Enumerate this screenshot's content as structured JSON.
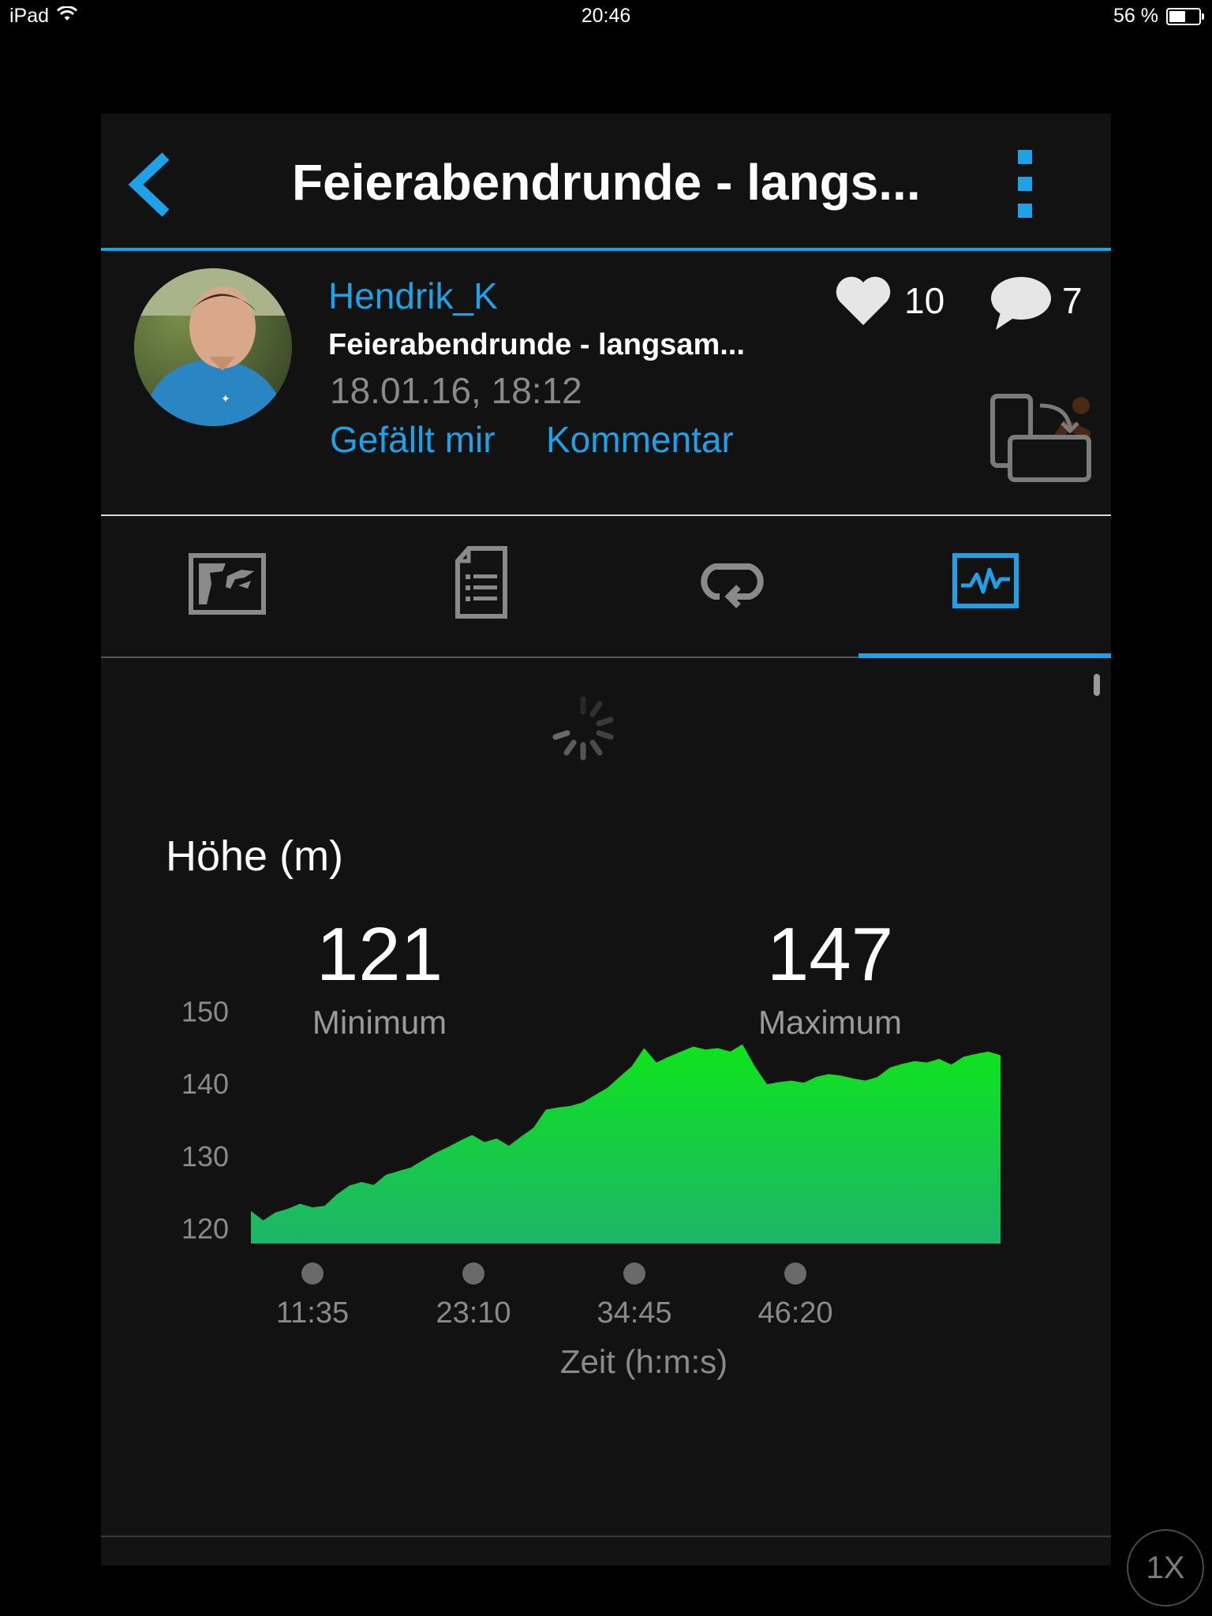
{
  "status_bar": {
    "carrier": "iPad",
    "time": "20:46",
    "battery": "56 %"
  },
  "header": {
    "title": "Feierabendrunde - langs..."
  },
  "activity": {
    "user": "Hendrik_K",
    "name": "Feierabendrunde - langsam...",
    "datetime": "18.01.16, 18:12",
    "like_label": "Gefällt mir",
    "comment_label": "Kommentar",
    "likes": "10",
    "comments": "7"
  },
  "tabs": [
    {
      "name": "map",
      "icon": "map-icon",
      "active": false
    },
    {
      "name": "details",
      "icon": "document-list-icon",
      "active": false
    },
    {
      "name": "laps",
      "icon": "loop-icon",
      "active": false
    },
    {
      "name": "charts",
      "icon": "chart-icon",
      "active": true
    }
  ],
  "elevation": {
    "title": "Höhe (m)",
    "min_value": "121",
    "min_label": "Minimum",
    "max_value": "147",
    "max_label": "Maximum"
  },
  "chart_data": {
    "type": "area",
    "ylim": [
      118,
      152
    ],
    "yticks": [
      "150",
      "140",
      "130",
      "120"
    ],
    "xticks": [
      "11:35",
      "23:10",
      "34:45",
      "46:20"
    ],
    "xlabel": "Zeit (h:m:s)",
    "color_top": "#0ee41c",
    "color_bottom": "#1db56a",
    "x": [
      0,
      1,
      2,
      3,
      4,
      5,
      6,
      7,
      8,
      9,
      10,
      11,
      12,
      13,
      14,
      15,
      16,
      17,
      18,
      19,
      20,
      21,
      22,
      23,
      24,
      25,
      26,
      27,
      28,
      29,
      30,
      31,
      32,
      33,
      34,
      35,
      36,
      37,
      38,
      39,
      40,
      41,
      42,
      43,
      44,
      45,
      46,
      47,
      48,
      49,
      50,
      51,
      52,
      53,
      54,
      55,
      56,
      57,
      58,
      59,
      60,
      61
    ],
    "values": [
      122.5,
      121.2,
      122.3,
      122.8,
      123.5,
      123.0,
      123.2,
      124.8,
      126.0,
      126.5,
      126.1,
      127.5,
      128.0,
      128.5,
      129.5,
      130.5,
      131.3,
      132.2,
      133.0,
      132.0,
      132.5,
      131.5,
      132.8,
      134.0,
      136.5,
      136.8,
      137.0,
      137.5,
      138.5,
      139.5,
      141.0,
      142.5,
      145.0,
      143.0,
      143.8,
      144.5,
      145.2,
      144.8,
      145.0,
      144.5,
      145.5,
      142.5,
      140.0,
      140.3,
      140.5,
      140.2,
      141.0,
      141.4,
      141.2,
      140.8,
      140.5,
      141.0,
      142.3,
      142.8,
      143.2,
      143.0,
      143.5,
      142.7,
      143.8,
      144.2,
      144.5,
      144.0
    ]
  },
  "zoom": "1X"
}
